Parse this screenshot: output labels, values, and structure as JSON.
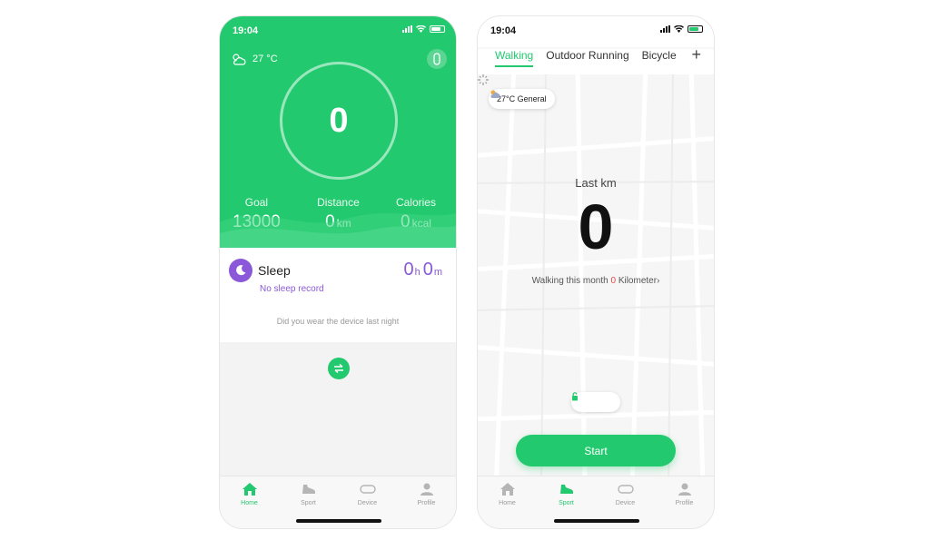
{
  "colors": {
    "accent": "#23c96e",
    "sleep": "#8a58d8",
    "highlight": "#e04a4a"
  },
  "home_screen": {
    "status_time": "19:04",
    "weather": "27 °C",
    "ring_value": "0",
    "stats": [
      {
        "label": "Goal",
        "value": "13000",
        "unit": ""
      },
      {
        "label": "Distance",
        "value": "0",
        "unit": "km"
      },
      {
        "label": "Calories",
        "value": "0",
        "unit": "kcal"
      }
    ],
    "sleep": {
      "title": "Sleep",
      "hours": "0",
      "hours_unit": "h",
      "minutes": "0",
      "minutes_unit": "m",
      "no_record": "No sleep record",
      "hint": "Did you wear the device last night"
    }
  },
  "sport_screen": {
    "status_time": "19:04",
    "tabs": [
      "Walking",
      "Outdoor Running",
      "Bicycle"
    ],
    "active_tab": "Walking",
    "plus_label": "+",
    "weather": "27°C General",
    "last_km_label": "Last km",
    "last_km_value": "0",
    "month_prefix": "Walking this month",
    "month_value": "0",
    "month_suffix": "Kilometer",
    "start_label": "Start"
  },
  "tabbar": {
    "items": [
      {
        "label": "Home",
        "icon": "home-icon"
      },
      {
        "label": "Sport",
        "icon": "shoe-icon"
      },
      {
        "label": "Device",
        "icon": "band-icon"
      },
      {
        "label": "Profile",
        "icon": "person-icon"
      }
    ]
  }
}
